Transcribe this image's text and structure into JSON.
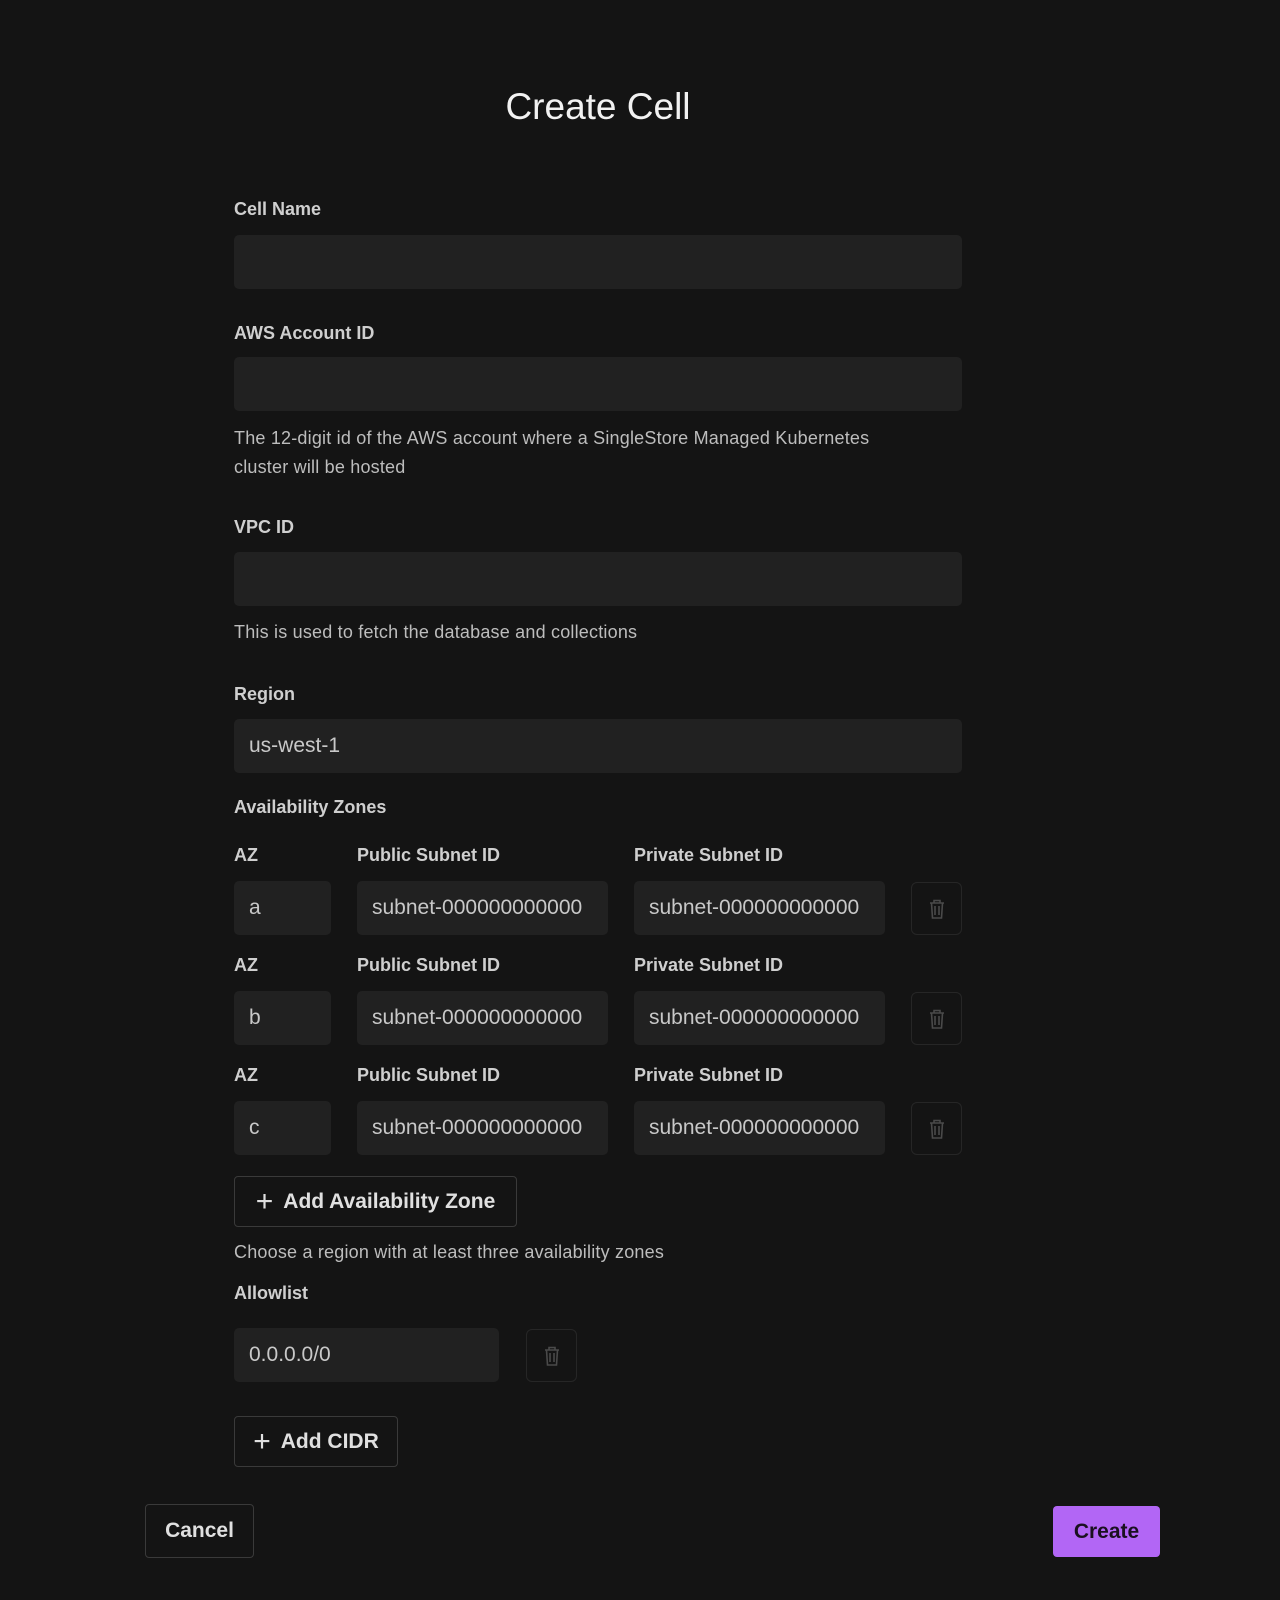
{
  "title": "Create Cell",
  "fields": {
    "cell_name": {
      "label": "Cell Name",
      "value": ""
    },
    "aws_account_id": {
      "label": "AWS Account ID",
      "value": "",
      "help_line1": "The 12-digit id of the AWS account where a SingleStore Managed Kubernetes",
      "help_line2": "cluster will be hosted"
    },
    "vpc_id": {
      "label": "VPC ID",
      "value": "",
      "help": "This is used to fetch the database and collections"
    },
    "region": {
      "label": "Region",
      "value": "us-west-1"
    }
  },
  "availability_zones": {
    "label": "Availability Zones",
    "col_az": "AZ",
    "col_public": "Public Subnet ID",
    "col_private": "Private Subnet ID",
    "rows": [
      {
        "az": "a",
        "public": "subnet-000000000000",
        "private": "subnet-000000000000"
      },
      {
        "az": "b",
        "public": "subnet-000000000000",
        "private": "subnet-000000000000"
      },
      {
        "az": "c",
        "public": "subnet-000000000000",
        "private": "subnet-000000000000"
      }
    ],
    "add_label": "Add Availability Zone",
    "help": "Choose a region with at least three availability zones"
  },
  "allowlist": {
    "label": "Allowlist",
    "entries": [
      "0.0.0.0/0"
    ],
    "add_label": "Add CIDR"
  },
  "footer": {
    "cancel": "Cancel",
    "create": "Create"
  },
  "colors": {
    "accent": "#b266f5",
    "background": "#141414",
    "input": "#212121"
  }
}
